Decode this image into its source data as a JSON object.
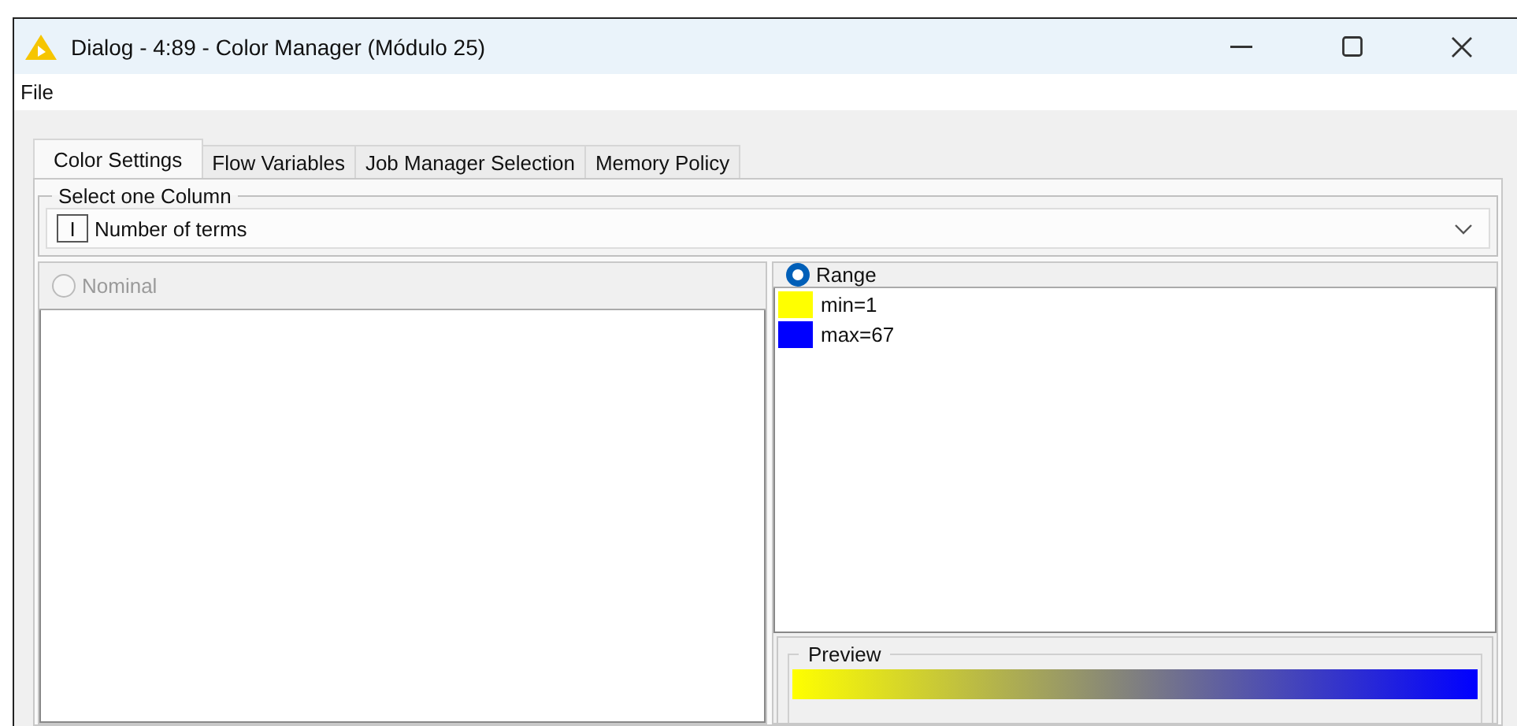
{
  "window": {
    "title": "Dialog - 4:89 - Color Manager (Módulo 25)"
  },
  "menu": [
    "File"
  ],
  "tabs": [
    {
      "label": "Color Settings",
      "selected": true
    },
    {
      "label": "Flow Variables",
      "selected": false
    },
    {
      "label": "Job Manager Selection",
      "selected": false
    },
    {
      "label": "Memory Policy",
      "selected": false
    }
  ],
  "column_select": {
    "label": "Select one Column",
    "type_icon": "I",
    "value": "Number of terms"
  },
  "modes": [
    {
      "label": "Nominal",
      "selected": false,
      "disabled": true
    },
    {
      "label": "Range",
      "selected": true,
      "disabled": false
    }
  ],
  "range_items": [
    {
      "label": "min=1",
      "color": "#ffff00"
    },
    {
      "label": "max=67",
      "color": "#0000ff"
    }
  ],
  "preview": {
    "label": "Preview"
  }
}
